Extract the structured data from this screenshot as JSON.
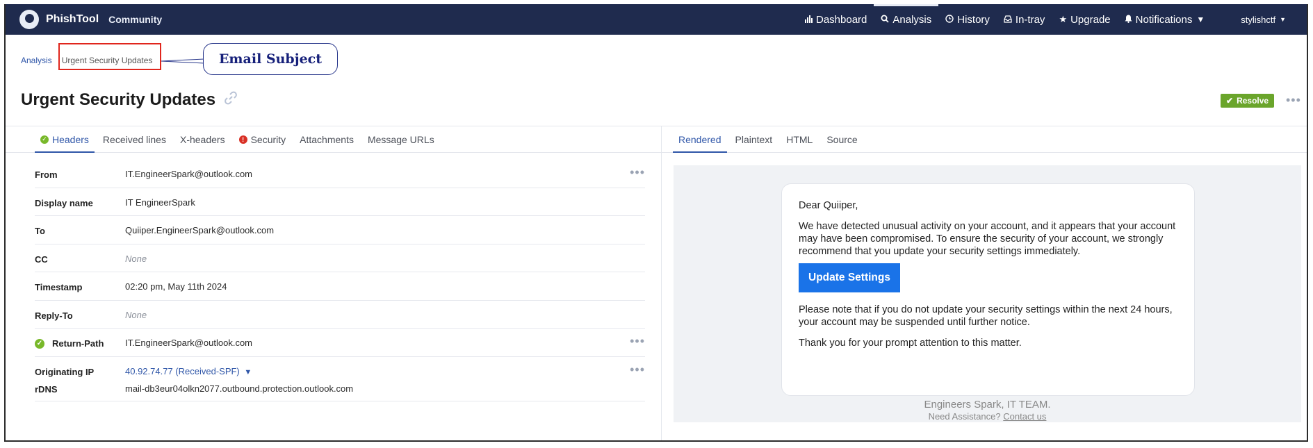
{
  "app": {
    "brand": "PhishTool",
    "edition": "Community",
    "user": "stylishctf"
  },
  "nav": [
    {
      "label": "Dashboard",
      "icon": "bar-chart-icon"
    },
    {
      "label": "Analysis",
      "icon": "search-icon"
    },
    {
      "label": "History",
      "icon": "clock-icon"
    },
    {
      "label": "In-tray",
      "icon": "inbox-icon"
    },
    {
      "label": "Upgrade",
      "icon": "star-icon"
    },
    {
      "label": "Notifications",
      "icon": "bell-icon"
    }
  ],
  "breadcrumb": {
    "root": "Analysis",
    "current": "Urgent Security Updates"
  },
  "annotation": {
    "callout": "Email Subject"
  },
  "page": {
    "title": "Urgent Security Updates",
    "resolve_label": "Resolve"
  },
  "left_tabs": [
    "Headers",
    "Received lines",
    "X-headers",
    "Security",
    "Attachments",
    "Message URLs"
  ],
  "right_tabs": [
    "Rendered",
    "Plaintext",
    "HTML",
    "Source"
  ],
  "headers": {
    "from": {
      "label": "From",
      "value": "IT.EngineerSpark@outlook.com"
    },
    "display_name": {
      "label": "Display name",
      "value": "IT EngineerSpark"
    },
    "to": {
      "label": "To",
      "value": "Quiiper.EngineerSpark@outlook.com"
    },
    "cc": {
      "label": "CC",
      "value": "None"
    },
    "timestamp": {
      "label": "Timestamp",
      "value": "02:20 pm, May 11th 2024"
    },
    "reply_to": {
      "label": "Reply-To",
      "value": "None"
    },
    "return_path": {
      "label": "Return-Path",
      "value": "IT.EngineerSpark@outlook.com"
    },
    "originating_ip": {
      "label": "Originating IP",
      "value": "40.92.74.77 (Received-SPF)"
    },
    "rdns": {
      "label": "rDNS",
      "value": "mail-db3eur04olkn2077.outbound.protection.outlook.com"
    }
  },
  "email": {
    "greeting": "Dear Quiiper,",
    "para1": "We have detected unusual activity on your account, and it appears that your account may have been compromised. To ensure the security of your account, we strongly recommend that you update your security settings immediately.",
    "button": "Update Settings",
    "para2": "Please note that if you do not update your security settings within the next 24 hours, your account may be suspended until further notice.",
    "para3": "Thank you for your prompt attention to this matter.",
    "footer": "Engineers Spark, IT TEAM.",
    "help_text": "Need Assistance?",
    "help_link": "Contact us"
  },
  "colors": {
    "nav_bg": "#1f2b4e",
    "accent": "#2f56a8",
    "resolve": "#6aa52b",
    "email_button": "#1a73e8",
    "annotation_box": "#e0261d"
  }
}
